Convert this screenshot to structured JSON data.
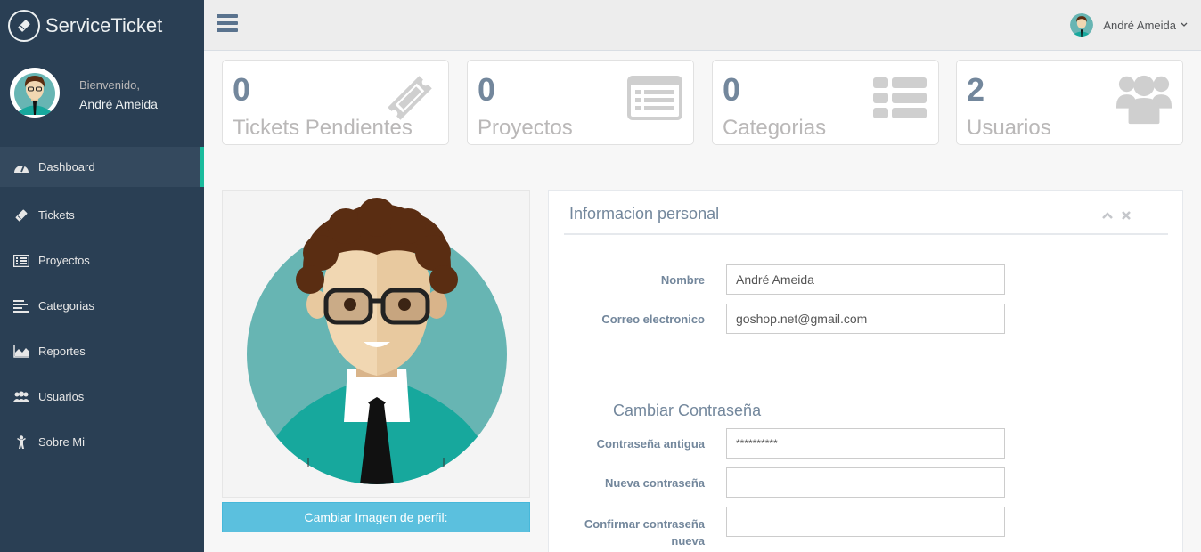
{
  "brand": {
    "name": "ServiceTicket"
  },
  "profile": {
    "welcome": "Bienvenido,",
    "name": "André Ameida"
  },
  "nav": [
    {
      "label": "Dashboard",
      "icon": "dashboard-icon",
      "active": true
    },
    {
      "label": "Tickets",
      "icon": "ticket-icon"
    },
    {
      "label": "Proyectos",
      "icon": "list-alt-icon"
    },
    {
      "label": "Categorias",
      "icon": "align-left-icon"
    },
    {
      "label": "Reportes",
      "icon": "area-chart-icon"
    },
    {
      "label": "Usuarios",
      "icon": "users-icon"
    },
    {
      "label": "Sobre Mi",
      "icon": "child-icon"
    }
  ],
  "topbar": {
    "user_name": "André Ameida"
  },
  "stats": [
    {
      "count": "0",
      "label": "Tickets Pendientes",
      "icon": "ticket-icon"
    },
    {
      "count": "0",
      "label": "Proyectos",
      "icon": "list-alt-icon"
    },
    {
      "count": "0",
      "label": "Categorias",
      "icon": "th-list-icon"
    },
    {
      "count": "2",
      "label": "Usuarios",
      "icon": "users-icon"
    }
  ],
  "avatar_panel": {
    "button_label": "Cambiar Imagen de perfil:"
  },
  "personal_info": {
    "title": "Informacion personal",
    "name_label": "Nombre",
    "name_value": "André Ameida",
    "email_label": "Correo electronico",
    "email_value": "goshop.net@gmail.com",
    "password_section_title": "Cambiar Contraseña",
    "old_password_label": "Contraseña antigua",
    "old_password_value": "**********",
    "new_password_label": "Nueva contraseña",
    "new_password_value": "",
    "confirm_password_label": "Confirmar contraseña nueva",
    "confirm_password_value": ""
  },
  "colors": {
    "sidebar": "#2a3f54",
    "accent": "#1abb9c",
    "button": "#5bc0de"
  }
}
